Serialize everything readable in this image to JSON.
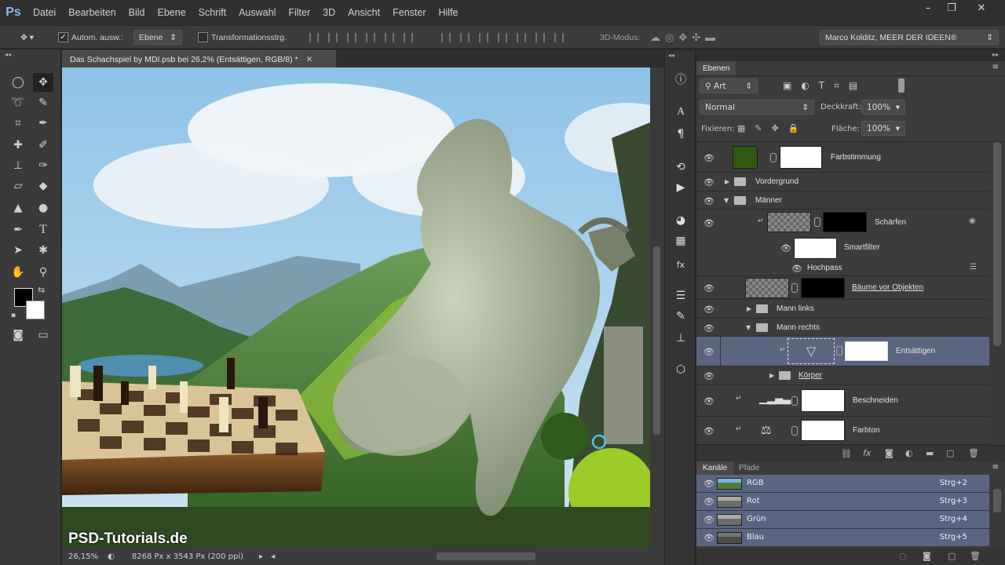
{
  "app": {
    "logo": "Ps"
  },
  "menu": [
    "Datei",
    "Bearbeiten",
    "Bild",
    "Ebene",
    "Schrift",
    "Auswahl",
    "Filter",
    "3D",
    "Ansicht",
    "Fenster",
    "Hilfe"
  ],
  "window_controls": [
    "–",
    "❐",
    "✕"
  ],
  "options": {
    "auto_select_label": "Autom. ausw.:",
    "auto_select_value": "Ebene",
    "transform_label": "Transformationsstrg.",
    "mode3d_label": "3D-Modus:",
    "workspace": "Marco Kolditz, MEER DER IDEEN®"
  },
  "document": {
    "tab_title": "Das Schachspiel by MDI.psb bei 26,2% (Entsättigen, RGB/8) *",
    "watermark": "PSD-Tutorials.de",
    "zoom": "26,15%",
    "dimensions": "8268 Px x 3543 Px (200 ppi)"
  },
  "layers_panel": {
    "tab": "Ebenen",
    "filter_kind": "Art",
    "blend_mode": "Normal",
    "opacity_label": "Deckkraft:",
    "opacity": "100%",
    "lock_label": "Fixieren:",
    "fill_label": "Fläche:",
    "fill": "100%",
    "layers": [
      {
        "name": "Farbstimmung"
      },
      {
        "name": "Vordergrund"
      },
      {
        "name": "Männer"
      },
      {
        "name": "Schärfen"
      },
      {
        "name": "Smartfilter"
      },
      {
        "name": "Hochpass"
      },
      {
        "name": "Bäume vor Objekten"
      },
      {
        "name": "Mann links"
      },
      {
        "name": "Mann rechts"
      },
      {
        "name": "Entsättigen",
        "selected": true
      },
      {
        "name": "Körper"
      },
      {
        "name": "Beschneiden"
      },
      {
        "name": "Farbton"
      }
    ]
  },
  "channels_panel": {
    "tabs": [
      "Kanäle",
      "Pfade"
    ],
    "channels": [
      {
        "name": "RGB",
        "shortcut": "Strg+2"
      },
      {
        "name": "Rot",
        "shortcut": "Strg+3"
      },
      {
        "name": "Grün",
        "shortcut": "Strg+4"
      },
      {
        "name": "Blau",
        "shortcut": "Strg+5"
      }
    ]
  },
  "colors": {
    "selected_row": "#5a6580",
    "panel_bg": "#3c3c3c",
    "accent_green": "#2f5a10"
  }
}
